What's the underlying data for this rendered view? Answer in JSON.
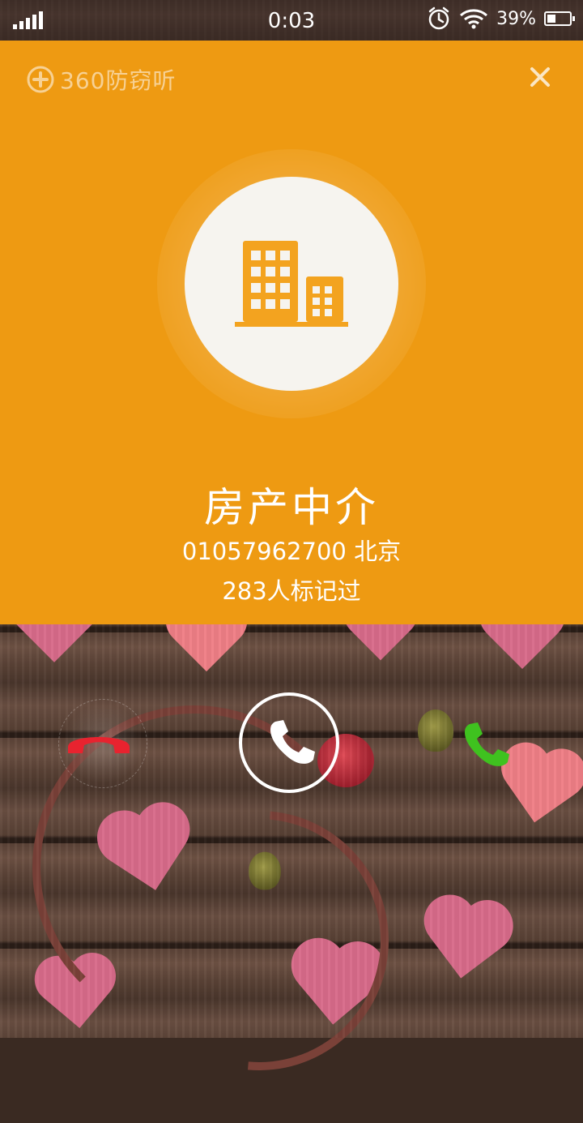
{
  "status_bar": {
    "time": "0:03",
    "battery_percent": "39%",
    "battery_level": 0.39
  },
  "card": {
    "brand": "360防窃听",
    "caller_name": "房产中介",
    "caller_info": "01057962700 北京",
    "mark_count": "283人标记过",
    "accent_color": "#ee9a12"
  },
  "controls": {
    "decline_color": "#e8232f",
    "accept_color": "#3fc21f"
  }
}
